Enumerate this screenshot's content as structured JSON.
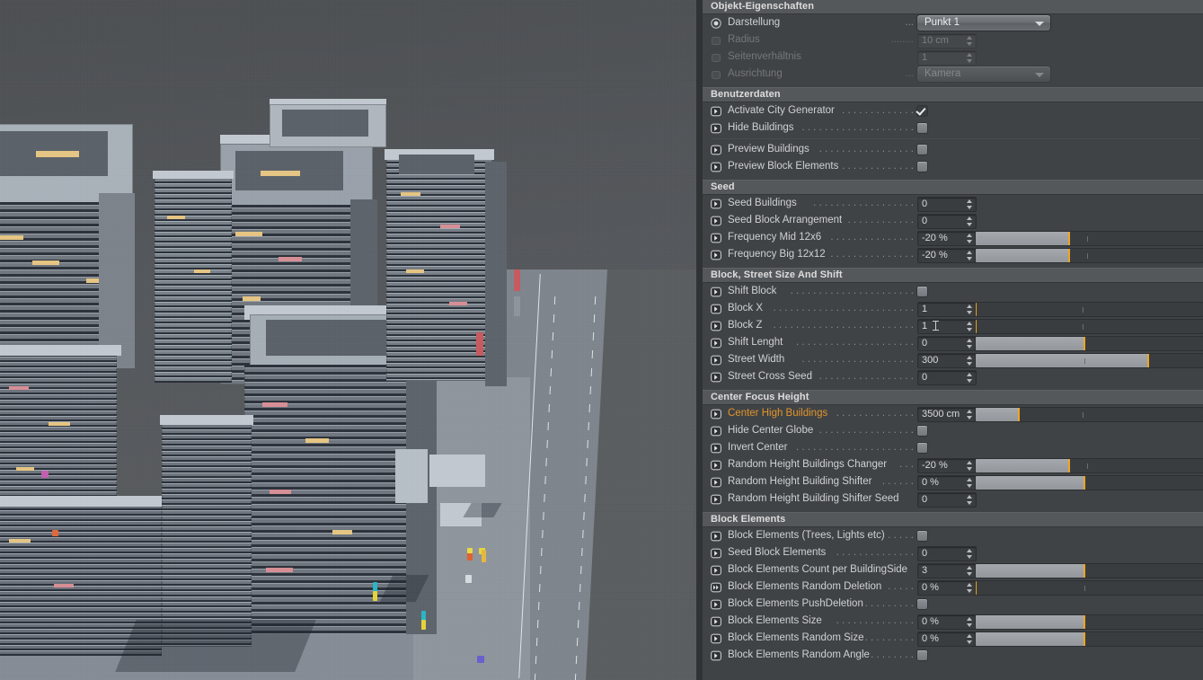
{
  "panel": {
    "sections": [
      {
        "title": "Objekt-Eigenschaften",
        "rows": [
          {
            "icon": "radio-icon",
            "label": "Darstellung",
            "dots": "...",
            "control": "dropdown",
            "value": "Punkt 1",
            "disabled": false
          },
          {
            "icon": "track-icon",
            "label": "Radius",
            "dots": "........",
            "control": "number",
            "value": "10 cm",
            "disabled": true
          },
          {
            "icon": "track-icon",
            "label": "Seitenverhältnis",
            "dots": "",
            "control": "number",
            "value": "1",
            "disabled": true
          },
          {
            "icon": "track-icon",
            "label": "Ausrichtung",
            "dots": "...",
            "control": "dropdown",
            "value": "Kamera",
            "disabled": true
          }
        ]
      },
      {
        "title": "Benutzerdaten",
        "rows": [
          {
            "icon": "animate-icon",
            "label": "Activate City Generator",
            "dots": ". . . . . . . . . . . . .",
            "control": "checkbox",
            "checked": true
          },
          {
            "icon": "animate-icon",
            "label": "Hide Buildings",
            "dots": ". . . . . . . . . . . . . . . . . . . .",
            "control": "checkbox",
            "checked": false
          },
          {
            "control": "divider"
          },
          {
            "icon": "animate-icon",
            "label": "Preview Buildings",
            "dots": ". . . . . . . . . . . . . . . . .",
            "control": "checkbox",
            "checked": false
          },
          {
            "icon": "animate-icon",
            "label": "Preview Block Elements",
            "dots": ". . . . . . . . . . . . .",
            "control": "checkbox",
            "checked": false
          }
        ]
      },
      {
        "title": "Seed",
        "rows": [
          {
            "icon": "animate-icon",
            "label": "Seed Buildings",
            "dots": ". . . . . . . . . . . . . . . . . .",
            "control": "number",
            "value": "0"
          },
          {
            "icon": "animate-icon",
            "label": "Seed Block Arrangement",
            "dots": ". . . . . . . . . . . .",
            "control": "number",
            "value": "0"
          },
          {
            "icon": "animate-icon",
            "label": "Frequency Mid 12x6",
            "dots": ". . . . . . . . . . . . . . .",
            "control": "slider",
            "value": "-20 %",
            "fill": 41,
            "mark": 41,
            "tick": 49
          },
          {
            "icon": "animate-icon",
            "label": "Frequency Big 12x12",
            "dots": ". . . . . . . . . . . . . . .",
            "control": "slider",
            "value": "-20 %",
            "fill": 41,
            "mark": 41,
            "tick": 49
          }
        ]
      },
      {
        "title": "Block, Street Size And Shift",
        "rows": [
          {
            "icon": "animate-icon",
            "label": "Shift Block",
            "dots": ". . . . . . . . . . . . . . . . . . . . . .",
            "control": "checkbox",
            "checked": false
          },
          {
            "icon": "animate-icon",
            "label": "Block X",
            "dots": ". . . . . . . . . . . . . . . . . . . . . . . . .",
            "control": "slider",
            "value": "1",
            "fill": 0,
            "mark": 0,
            "tick": 47
          },
          {
            "icon": "animate-icon",
            "label": "Block Z",
            "dots": ". . . . . . . . . . . . . . . . . . . . . . . . .",
            "control": "slider",
            "value": "1",
            "fill": 0,
            "mark": 0,
            "tick": 47,
            "caret": true
          },
          {
            "icon": "animate-icon",
            "label": "Shift Lenght",
            "dots": ". . . . . . . . . . . . . . . . . . . . .",
            "control": "slider",
            "value": "0",
            "fill": 48,
            "mark": 48,
            "tick": 48
          },
          {
            "icon": "animate-icon",
            "label": "Street Width",
            "dots": ". . . . . . . . . . . . . . . . . . . .",
            "control": "slider",
            "value": "300",
            "fill": 76,
            "mark": 76,
            "tick": 48
          },
          {
            "icon": "animate-icon",
            "label": "Street Cross Seed",
            "dots": ". . . . . . . . . . . . . . . . .",
            "control": "number",
            "value": "0"
          }
        ]
      },
      {
        "title": "Center Focus Height",
        "rows": [
          {
            "icon": "animate-icon",
            "label": "Center High Buildings",
            "dots": ". . . . . . . . . . . . . .",
            "control": "slider",
            "value": "3500 cm",
            "fill": 19,
            "mark": 19,
            "tick": 47,
            "highlight": true
          },
          {
            "icon": "animate-icon",
            "label": "Hide Center Globe",
            "dots": ". . . . . . . . . . . . . . . . .",
            "control": "checkbox",
            "checked": false
          },
          {
            "icon": "animate-icon",
            "label": "Invert Center",
            "dots": ". . . . . . . . . . . . . . . . . . . . .",
            "control": "checkbox",
            "checked": false
          },
          {
            "icon": "animate-icon",
            "label": "Random Height Buildings Changer",
            "dots": ". . .",
            "control": "slider",
            "value": "-20 %",
            "fill": 41,
            "mark": 41,
            "tick": 49
          },
          {
            "icon": "animate-icon",
            "label": "Random Height Building Shifter",
            "dots": ". . . . . .",
            "control": "slider",
            "value": "0 %",
            "fill": 48,
            "mark": 48,
            "tick": 48
          },
          {
            "icon": "animate-icon",
            "label": "Random Height Building Shifter Seed",
            "dots": "",
            "control": "number",
            "value": "0"
          }
        ]
      },
      {
        "title": "Block Elements",
        "rows": [
          {
            "icon": "animate-icon",
            "label": "Block Elements (Trees, Lights etc)",
            "dots": ". . . . .",
            "control": "checkbox",
            "checked": false
          },
          {
            "icon": "animate-icon",
            "label": "Seed Block Elements",
            "dots": ". . . . . . . . . . . . . .",
            "control": "number",
            "value": "0"
          },
          {
            "icon": "animate-icon",
            "label": "Block Elements Count per BuildingSide",
            "dots": "",
            "control": "slider",
            "value": "3",
            "fill": 48,
            "mark": 48,
            "tick": 48
          },
          {
            "icon": "keyframe-icon",
            "label": "Block Elements Random Deletion",
            "dots": ". . . . .",
            "control": "slider",
            "value": "0 %",
            "fill": 0,
            "mark": 0,
            "tick": 48
          },
          {
            "icon": "animate-icon",
            "label": "Block Elements PushDeletion",
            "dots": ". . . . . . . . .",
            "control": "checkbox",
            "checked": false
          },
          {
            "icon": "animate-icon",
            "label": "Block Elements Size",
            "dots": ". . . . . . . . . . . . . .",
            "control": "slider",
            "value": "0 %",
            "fill": 48,
            "mark": 48,
            "tick": 48
          },
          {
            "icon": "animate-icon",
            "label": "Block Elements Random Size",
            "dots": ". . . . . . . . .",
            "control": "slider",
            "value": "0 %",
            "fill": 48,
            "mark": 48,
            "tick": 48
          },
          {
            "icon": "animate-icon",
            "label": "Block Elements Random Angle",
            "dots": ". . . . . . . .",
            "control": "checkbox",
            "checked": false
          }
        ]
      }
    ]
  },
  "viewport": {
    "name": "3d-viewport",
    "scene": "procedural city generator render",
    "sky_color": "#55585b"
  },
  "colors": {
    "accent": "#f0a423",
    "panel_bg": "#404346",
    "section_bg": "#55585b",
    "field_bg": "#3a3d40",
    "text": "#cfd2d5",
    "text_dim": "#74777a",
    "highlight_text": "#e2952b"
  }
}
